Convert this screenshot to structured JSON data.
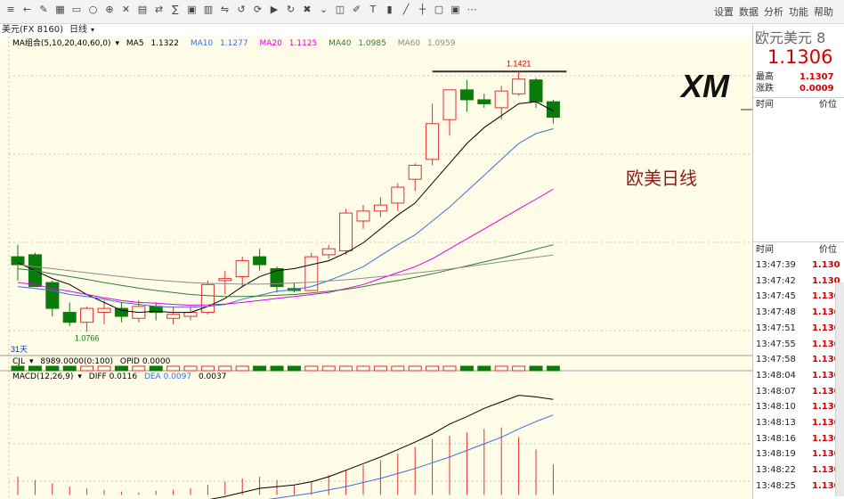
{
  "toolbar": {
    "icons": [
      "menu-icon",
      "back-icon",
      "draw-icon",
      "chart-icon",
      "layout-icon",
      "circle-icon",
      "zoom-in-icon",
      "cross-icon",
      "grid-icon",
      "period-icon",
      "indicator-icon",
      "stock-icon",
      "month-icon",
      "compare-icon",
      "history-icon",
      "sync-icon",
      "play-icon",
      "refresh-icon",
      "close-icon",
      "down-icon",
      "f10-icon",
      "pen-icon",
      "text-icon",
      "bar-icon",
      "line-icon",
      "tick-icon",
      "screen-icon",
      "window-icon",
      "more-icon"
    ],
    "right_items": [
      "设置",
      "数据",
      "分析",
      "功能",
      "帮助"
    ]
  },
  "tabbar": {
    "symbol": "美元(FX 8160)",
    "period": "日线"
  },
  "colors": {
    "up": "#e03030",
    "down": "#0a7a0a",
    "ma5": "#000000",
    "ma10": "#3a6fd8",
    "ma20": "#e000e0",
    "ma40": "#2e7d32",
    "ma60": "#8c8c8c",
    "price_red": "#d40000"
  },
  "chart_data": [
    {
      "type": "candlestick",
      "title": "欧美日线",
      "indicator_label": "MA组合(5,10,20,40,60,0)",
      "ma_labels": [
        {
          "name": "MA5",
          "value": "1.1322"
        },
        {
          "name": "MA10",
          "value": "1.1277"
        },
        {
          "name": "MA20",
          "value": "1.1125"
        },
        {
          "name": "MA40",
          "value": "1.0985"
        },
        {
          "name": "MA60",
          "value": "1.0959"
        }
      ],
      "high_annotation": "1.1421",
      "low_annotation": "1.0766",
      "period_label": "31天",
      "ylim": [
        1.074,
        1.148
      ],
      "candles": [
        {
          "o": 1.0955,
          "h": 1.0985,
          "l": 1.0895,
          "c": 1.0935
        },
        {
          "o": 1.096,
          "h": 1.0965,
          "l": 1.09,
          "c": 1.088
        },
        {
          "o": 1.089,
          "h": 1.0895,
          "l": 1.0805,
          "c": 1.0825
        },
        {
          "o": 1.0815,
          "h": 1.084,
          "l": 1.078,
          "c": 1.079
        },
        {
          "o": 1.079,
          "h": 1.083,
          "l": 1.0766,
          "c": 1.0825
        },
        {
          "o": 1.0815,
          "h": 1.0845,
          "l": 1.0785,
          "c": 1.0825
        },
        {
          "o": 1.0825,
          "h": 1.084,
          "l": 1.079,
          "c": 1.0805
        },
        {
          "o": 1.08,
          "h": 1.0845,
          "l": 1.079,
          "c": 1.083
        },
        {
          "o": 1.083,
          "h": 1.084,
          "l": 1.0795,
          "c": 1.0815
        },
        {
          "o": 1.08,
          "h": 1.083,
          "l": 1.0785,
          "c": 1.081
        },
        {
          "o": 1.0805,
          "h": 1.083,
          "l": 1.0795,
          "c": 1.0815
        },
        {
          "o": 1.0815,
          "h": 1.0895,
          "l": 1.081,
          "c": 1.0885
        },
        {
          "o": 1.0895,
          "h": 1.092,
          "l": 1.086,
          "c": 1.09
        },
        {
          "o": 1.0905,
          "h": 1.0955,
          "l": 1.088,
          "c": 1.0945
        },
        {
          "o": 1.0955,
          "h": 1.0975,
          "l": 1.092,
          "c": 1.0935
        },
        {
          "o": 1.0925,
          "h": 1.093,
          "l": 1.0865,
          "c": 1.088
        },
        {
          "o": 1.0875,
          "h": 1.089,
          "l": 1.0865,
          "c": 1.087
        },
        {
          "o": 1.087,
          "h": 1.0965,
          "l": 1.087,
          "c": 1.0955
        },
        {
          "o": 1.096,
          "h": 1.0985,
          "l": 1.095,
          "c": 1.0975
        },
        {
          "o": 1.097,
          "h": 1.1075,
          "l": 1.096,
          "c": 1.1065
        },
        {
          "o": 1.1045,
          "h": 1.1085,
          "l": 1.1025,
          "c": 1.107
        },
        {
          "o": 1.107,
          "h": 1.1105,
          "l": 1.1055,
          "c": 1.1085
        },
        {
          "o": 1.109,
          "h": 1.114,
          "l": 1.107,
          "c": 1.113
        },
        {
          "o": 1.115,
          "h": 1.119,
          "l": 1.112,
          "c": 1.1185
        },
        {
          "o": 1.12,
          "h": 1.134,
          "l": 1.1185,
          "c": 1.129
        },
        {
          "o": 1.13,
          "h": 1.137,
          "l": 1.126,
          "c": 1.1375
        },
        {
          "o": 1.1375,
          "h": 1.14,
          "l": 1.132,
          "c": 1.135
        },
        {
          "o": 1.135,
          "h": 1.1365,
          "l": 1.133,
          "c": 1.134
        },
        {
          "o": 1.133,
          "h": 1.1385,
          "l": 1.13,
          "c": 1.1372
        },
        {
          "o": 1.1365,
          "h": 1.1421,
          "l": 1.136,
          "c": 1.1402
        },
        {
          "o": 1.14,
          "h": 1.1405,
          "l": 1.133,
          "c": 1.1345
        },
        {
          "o": 1.1345,
          "h": 1.135,
          "l": 1.129,
          "c": 1.1306
        }
      ],
      "ma_series": [
        {
          "name": "MA5",
          "values": [
            1.094,
            1.092,
            1.09,
            1.0885,
            1.086,
            1.084,
            1.082,
            1.0815,
            1.0818,
            1.0815,
            1.0815,
            1.083,
            1.085,
            1.088,
            1.0905,
            1.092,
            1.0925,
            1.0935,
            1.0945,
            1.0965,
            1.099,
            1.1025,
            1.106,
            1.109,
            1.114,
            1.119,
            1.124,
            1.128,
            1.131,
            1.134,
            1.1345,
            1.1322
          ]
        },
        {
          "name": "MA10",
          "values": [
            1.088,
            1.0875,
            1.087,
            1.086,
            1.0855,
            1.0848,
            1.084,
            1.0835,
            1.083,
            1.0828,
            1.0828,
            1.083,
            1.0835,
            1.0848,
            1.0858,
            1.0868,
            1.0872,
            1.088,
            1.0895,
            1.0912,
            1.093,
            1.0958,
            1.0985,
            1.101,
            1.1045,
            1.108,
            1.112,
            1.116,
            1.12,
            1.124,
            1.1265,
            1.1277
          ]
        },
        {
          "name": "MA20",
          "values": [
            1.089,
            1.0885,
            1.0875,
            1.0868,
            1.086,
            1.0852,
            1.0845,
            1.084,
            1.0838,
            1.0835,
            1.0833,
            1.0834,
            1.0836,
            1.084,
            1.0845,
            1.085,
            1.0855,
            1.086,
            1.0865,
            1.0875,
            1.0885,
            1.09,
            1.0915,
            1.093,
            1.095,
            1.0975,
            1.1,
            1.1025,
            1.105,
            1.1075,
            1.11,
            1.1125
          ]
        },
        {
          "name": "MA40",
          "values": [
            1.0925,
            1.092,
            1.0912,
            1.0905,
            1.0898,
            1.089,
            1.0883,
            1.0876,
            1.087,
            1.0865,
            1.086,
            1.0857,
            1.0855,
            1.0855,
            1.0856,
            1.0858,
            1.086,
            1.0864,
            1.0868,
            1.0873,
            1.088,
            1.0888,
            1.0895,
            1.0903,
            1.0912,
            1.0922,
            1.0932,
            1.0942,
            1.0952,
            1.0962,
            1.0974,
            1.0985
          ]
        },
        {
          "name": "MA60",
          "values": [
            1.0935,
            1.093,
            1.0925,
            1.092,
            1.0915,
            1.091,
            1.0905,
            1.09,
            1.0896,
            1.0893,
            1.089,
            1.0888,
            1.0887,
            1.0886,
            1.0886,
            1.0887,
            1.0889,
            1.0891,
            1.0894,
            1.0897,
            1.0901,
            1.0905,
            1.0909,
            1.0914,
            1.0919,
            1.0924,
            1.093,
            1.0936,
            1.0942,
            1.0948,
            1.0954,
            1.0959
          ]
        }
      ]
    },
    {
      "type": "bar",
      "indicator_label": "CJL",
      "values_label": "8989.0000(0:100)",
      "opid_label": "OPID 0.0000"
    },
    {
      "type": "line",
      "indicator_label": "MACD(12,26,9)",
      "diff_label": "DIFF 0.0116",
      "dea_label": "DEA 0.0097",
      "macd_label": "0.0037",
      "ylim": [
        -0.0005,
        0.014
      ],
      "macd": [
        0.0022,
        0.0018,
        0.0014,
        0.001,
        0.0008,
        0.0006,
        0.0004,
        0.0003,
        0.0005,
        0.0006,
        0.0008,
        0.0012,
        0.0016,
        0.002,
        0.0022,
        0.0018,
        0.0012,
        0.0016,
        0.0024,
        0.003,
        0.0036,
        0.0042,
        0.005,
        0.0058,
        0.0068,
        0.0072,
        0.0076,
        0.008,
        0.0082,
        0.007,
        0.0055,
        0.0037
      ],
      "diff": [
        -0.001,
        -0.0012,
        -0.0014,
        -0.0015,
        -0.0016,
        -0.0016,
        -0.0016,
        -0.0015,
        -0.0014,
        -0.0012,
        -0.001,
        -0.0006,
        -0.0002,
        0.0003,
        0.0008,
        0.001,
        0.0012,
        0.0016,
        0.0022,
        0.003,
        0.0038,
        0.0046,
        0.0055,
        0.0064,
        0.0074,
        0.0086,
        0.0095,
        0.0105,
        0.0113,
        0.0121,
        0.0119,
        0.0116
      ],
      "dea": [
        -0.0018,
        -0.0019,
        -0.002,
        -0.002,
        -0.002,
        -0.002,
        -0.002,
        -0.0019,
        -0.0018,
        -0.0017,
        -0.0016,
        -0.0014,
        -0.0012,
        -0.001,
        -0.0007,
        -0.0004,
        -0.0001,
        0.0002,
        0.0006,
        0.001,
        0.0015,
        0.002,
        0.0026,
        0.0032,
        0.0039,
        0.0046,
        0.0054,
        0.0062,
        0.007,
        0.008,
        0.0089,
        0.0097
      ]
    }
  ],
  "quote": {
    "name": "欧元美元",
    "code_fragment": "8",
    "price": "1.1306",
    "high_label": "最高",
    "high_value": "1.1307",
    "change_label": "涨跌",
    "change_value": "0.0009",
    "time_header": "时间",
    "price_header": "价位"
  },
  "ticks": [
    {
      "time": "13:47:39",
      "price": "1.130"
    },
    {
      "time": "13:47:42",
      "price": "1.130"
    },
    {
      "time": "13:47:45",
      "price": "1.130"
    },
    {
      "time": "13:47:48",
      "price": "1.130"
    },
    {
      "time": "13:47:51",
      "price": "1.130"
    },
    {
      "time": "13:47:55",
      "price": "1.130"
    },
    {
      "time": "13:47:58",
      "price": "1.130"
    },
    {
      "time": "13:48:04",
      "price": "1.130"
    },
    {
      "time": "13:48:07",
      "price": "1.130"
    },
    {
      "time": "13:48:10",
      "price": "1.130"
    },
    {
      "time": "13:48:13",
      "price": "1.130"
    },
    {
      "time": "13:48:16",
      "price": "1.130"
    },
    {
      "time": "13:48:19",
      "price": "1.130"
    },
    {
      "time": "13:48:22",
      "price": "1.130"
    },
    {
      "time": "13:48:25",
      "price": "1.130"
    }
  ],
  "logo_text": "XM"
}
